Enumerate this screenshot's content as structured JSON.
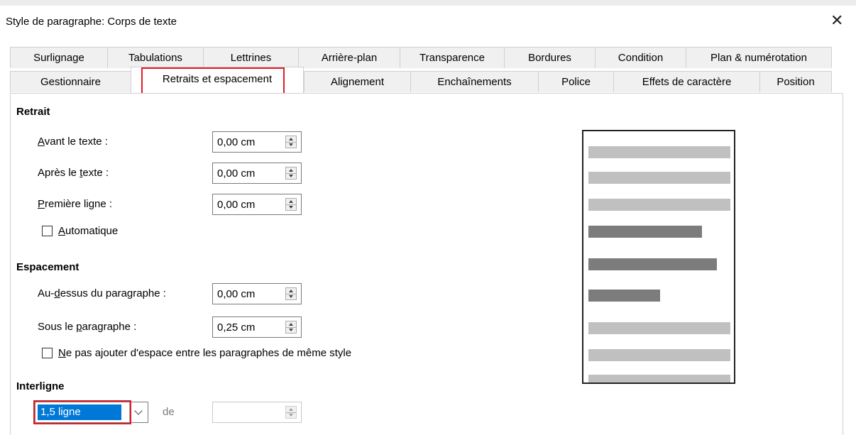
{
  "window": {
    "title": "Style de paragraphe: Corps de texte",
    "close_glyph": "✕"
  },
  "tabs": {
    "row1": [
      {
        "label": "Surlignage"
      },
      {
        "label": "Tabulations"
      },
      {
        "label": "Lettrines"
      },
      {
        "label": "Arrière-plan"
      },
      {
        "label": "Transparence"
      },
      {
        "label": "Bordures"
      },
      {
        "label": "Condition"
      },
      {
        "label": "Plan & numérotation"
      }
    ],
    "row2": [
      {
        "label": "Gestionnaire"
      },
      {
        "label": "Retraits et espacement"
      },
      {
        "label": "Alignement"
      },
      {
        "label": "Enchaînements"
      },
      {
        "label": "Police"
      },
      {
        "label": "Effets de caractère"
      },
      {
        "label": "Position"
      }
    ],
    "selected": "Retraits et espacement"
  },
  "retrait": {
    "heading": "Retrait",
    "avant_pre": "",
    "avant_u": "A",
    "avant_post": "vant le texte :",
    "avant_value": "0,00 cm",
    "apres_pre": "Après le ",
    "apres_u": "t",
    "apres_post": "exte :",
    "apres_value": "0,00 cm",
    "premiere_pre": "",
    "premiere_u": "P",
    "premiere_post": "remière ligne :",
    "premiere_value": "0,00 cm",
    "auto_u": "A",
    "auto_post": "utomatique",
    "auto_checked": false
  },
  "espacement": {
    "heading": "Espacement",
    "dessus_pre": "Au-",
    "dessus_u": "d",
    "dessus_post": "essus du paragraphe :",
    "dessus_value": "0,00 cm",
    "sous_pre": "Sous le ",
    "sous_u": "p",
    "sous_post": "aragraphe :",
    "sous_value": "0,25 cm",
    "nepas_u": "N",
    "nepas_post": "e pas ajouter d'espace entre les paragraphes de même style",
    "nepas_checked": false
  },
  "interligne": {
    "heading": "Interligne",
    "selected_value": "1,5 ligne",
    "de_label": "de",
    "de_value": ""
  },
  "colors": {
    "highlight_red": "#e01b24",
    "selection_blue": "#0078d7",
    "preview_light": "#c0c0c0",
    "preview_dark": "#7c7c7c"
  }
}
